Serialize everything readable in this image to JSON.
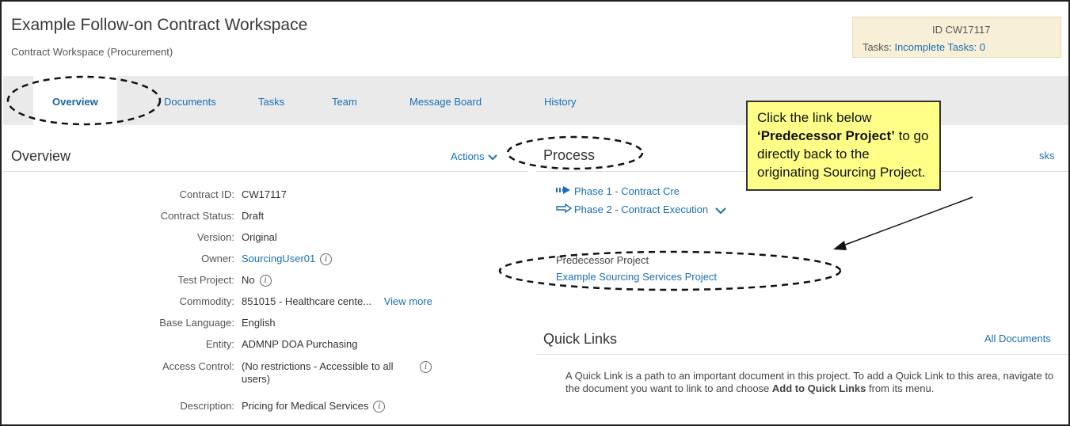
{
  "header": {
    "title": "Example Follow-on Contract Workspace",
    "subtitle": "Contract Workspace (Procurement)",
    "id_label": "ID CW17117",
    "tasks_label": "Tasks:",
    "tasks_link": "Incomplete Tasks: 0"
  },
  "tabs": [
    {
      "label": "Overview"
    },
    {
      "label": "Documents"
    },
    {
      "label": "Tasks"
    },
    {
      "label": "Team"
    },
    {
      "label": "Message Board"
    },
    {
      "label": "History"
    }
  ],
  "overview": {
    "title": "Overview",
    "actions_label": "Actions",
    "fields": [
      {
        "label": "Contract ID:",
        "value": "CW17117"
      },
      {
        "label": "Contract Status:",
        "value": "Draft"
      },
      {
        "label": "Version:",
        "value": "Original"
      },
      {
        "label": "Owner:",
        "value": "SourcingUser01"
      },
      {
        "label": "Test Project:",
        "value": "No"
      },
      {
        "label": "Commodity:",
        "value": "851015 - Healthcare cente...",
        "more": "View more"
      },
      {
        "label": "Base Language:",
        "value": "English"
      },
      {
        "label": "Entity:",
        "value": "ADMNP DOA Purchasing"
      },
      {
        "label": "Access Control:",
        "value": "(No restrictions - Accessible to all",
        "value2": "users)"
      },
      {
        "label": "Description:",
        "value": "Pricing for Medical Services"
      }
    ]
  },
  "process": {
    "title": "Process",
    "tasks_link_partial": "sks",
    "phases": [
      {
        "label": "Phase 1 - Contract Cre"
      },
      {
        "label": "Phase 2 - Contract Execution"
      }
    ],
    "predecessor_label": "Predecessor Project",
    "predecessor_link": "Example Sourcing Services Project"
  },
  "quick_links": {
    "title": "Quick Links",
    "all_documents": "All Documents",
    "text_1": "A Quick Link is a path to an important document in this project. To add a Quick Link to this area, navigate to the document you want to link to and choose ",
    "text_bold": "Add to Quick Links",
    "text_2": " from its menu."
  },
  "callout": {
    "line1": "Click the link below",
    "bold": "‘Predecessor Project’",
    "line2": " to go directly back to the originating Sourcing Project."
  },
  "icons": {
    "info": "info-icon",
    "phase_active": "double-arrow-icon",
    "phase_next": "outline-arrow-icon",
    "chevron": "chevron-down-icon"
  },
  "colors": {
    "link": "#1a6fb5",
    "id_box_bg": "#f7f0d7",
    "tab_bar_bg": "#eaeaea",
    "callout_bg": "#ffff88"
  }
}
